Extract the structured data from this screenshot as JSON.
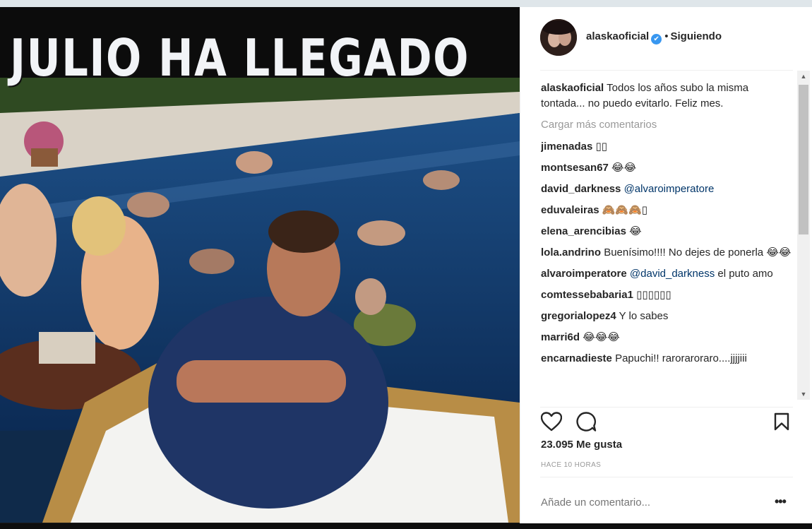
{
  "photo": {
    "caption": "JULIO HA LLEGADO"
  },
  "header": {
    "username": "alaskaoficial",
    "verified_glyph": "✔",
    "separator": "•",
    "follow_label": "Siguiendo"
  },
  "caption": {
    "username": "alaskaoficial",
    "text": "Todos los años subo la misma tontada... no puedo evitarlo. Feliz mes."
  },
  "load_more": "Cargar más comentarios",
  "comments": [
    {
      "user": "jimenadas",
      "text": "▯▯"
    },
    {
      "user": "montsesan67",
      "text": "😂😂"
    },
    {
      "user": "david_darkness",
      "mention": "@alvaroimperatore",
      "text": ""
    },
    {
      "user": "eduvaleiras",
      "text": "🙈🙈🙈▯"
    },
    {
      "user": "elena_arencibias",
      "text": "😂"
    },
    {
      "user": "lola.andrino",
      "text": "Buenísimo!!!! No dejes de ponerla 😂😂"
    },
    {
      "user": "alvaroimperatore",
      "mention": "@david_darkness",
      "text": "el puto amo"
    },
    {
      "user": "comtessebabaria1",
      "text": "▯▯▯▯▯▯"
    },
    {
      "user": "gregorialopez4",
      "text": "Y lo sabes"
    },
    {
      "user": "marri6d",
      "text": "😂😂😂"
    },
    {
      "user": "encarnadieste",
      "text": "Papuchi!! raroraroraro....jjjjiii"
    }
  ],
  "actions": {
    "icons": [
      "heart-icon",
      "comment-icon",
      "bookmark-icon"
    ]
  },
  "likes": "23.095 Me gusta",
  "time": "HACE 10 HORAS",
  "add_comment_placeholder": "Añade un comentario...",
  "more_options": "•••",
  "colors": {
    "link": "#003569",
    "verified": "#3897f0",
    "muted": "#999999",
    "text": "#262626"
  }
}
